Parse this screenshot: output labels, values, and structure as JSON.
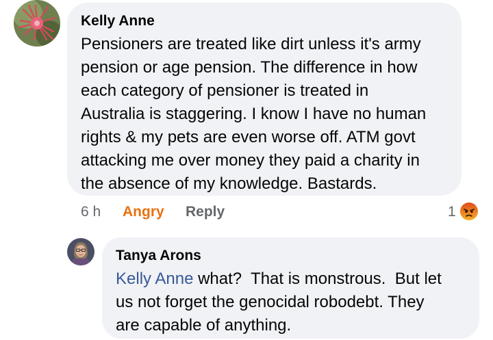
{
  "comments": [
    {
      "author": "Kelly Anne",
      "avatar_icon": "grevillea-flower-avatar",
      "text": "Pensioners are treated like dirt unless it's army pension or age pension. The difference in how each category of pensioner is treated in Australia is staggering. I know I have no human rights & my pets are even worse off. ATM govt attacking me over money they paid a charity in the absence of my knowledge. Bastards.",
      "lines": [
        "Pensioners are treated like dirt unless it's army",
        "pension or age pension. The difference in how",
        "each category of pensioner is treated in",
        "Australia is staggering. I know I have no human",
        "rights & my pets are even worse off. ATM govt",
        "attacking me over money they paid a charity in",
        "the absence of my knowledge. Bastards."
      ],
      "time": "6 h",
      "reaction_label": "Angry",
      "reply_label": "Reply",
      "reaction_count": "1",
      "reaction_icon": "angry-emoji-icon"
    }
  ],
  "replies": [
    {
      "author": "Tanya Arons",
      "avatar_icon": "woman-portrait-avatar",
      "mention": "Kelly Anne",
      "line1_rest": " what?  That is monstrous.  But let",
      "line2": "us not forget the genocidal robodebt. They",
      "line3": "are capable of anything."
    }
  ],
  "colors": {
    "bubble": "#f0f2f5",
    "mention": "#385898",
    "angry": "#e9710f",
    "meta": "#65676b"
  }
}
